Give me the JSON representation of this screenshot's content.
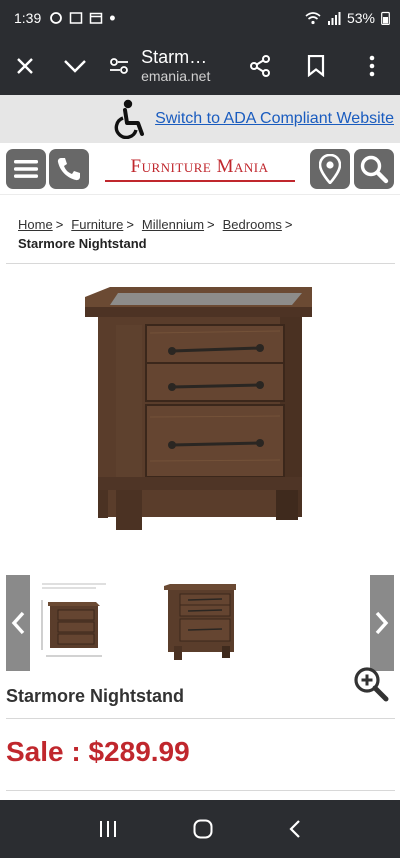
{
  "status": {
    "time": "1:39",
    "battery": "53%"
  },
  "browser": {
    "page_title": "Starm…",
    "page_url": "emania.net"
  },
  "ada": {
    "link_text": "Switch to ADA Compliant Website"
  },
  "site": {
    "logo_text": "Furniture Mania"
  },
  "breadcrumb": {
    "items": [
      "Home",
      "Furniture",
      "Millennium",
      "Bedrooms"
    ],
    "separator": ">",
    "current": "Starmore Nightstand"
  },
  "product": {
    "title": "Starmore Nightstand",
    "price_label": "Sale : $289.99"
  },
  "colors": {
    "accent_red": "#c0272d",
    "link_blue": "#1a5cbf",
    "chrome_dark": "#2b2d31",
    "wood": "#5a3d2b"
  },
  "icons": [
    "close-icon",
    "chevron-down-icon",
    "tune-icon",
    "share-icon",
    "bookmark-icon",
    "more-icon",
    "wheelchair-icon",
    "menu-icon",
    "phone-icon",
    "location-pin-icon",
    "search-icon",
    "chevron-left-icon",
    "chevron-right-icon",
    "zoom-in-icon",
    "recents-icon",
    "home-icon",
    "back-icon"
  ]
}
